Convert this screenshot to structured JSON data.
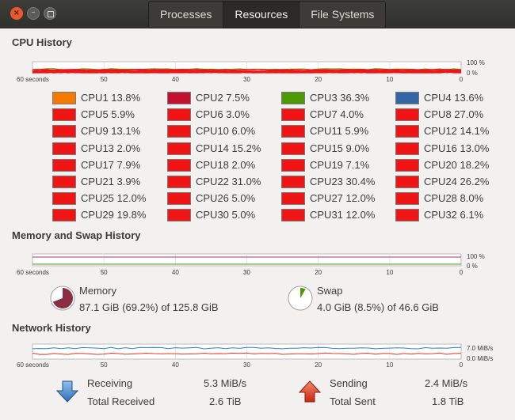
{
  "window": {
    "close_glyph": "×",
    "minimize_glyph": "–"
  },
  "tabs": [
    {
      "label": "Processes"
    },
    {
      "label": "Resources"
    },
    {
      "label": "File Systems"
    }
  ],
  "cpu_section": {
    "title": "CPU History",
    "axis_left": "60 seconds",
    "ticks": [
      "50",
      "40",
      "30",
      "20",
      "10",
      "0"
    ],
    "ymax": "100 %",
    "ymin": "0 %",
    "cpus": [
      {
        "label": "CPU1 13.8%",
        "color": "#f57900"
      },
      {
        "label": "CPU2 7.5%",
        "color": "#c4102f"
      },
      {
        "label": "CPU3 36.3%",
        "color": "#4e9a06"
      },
      {
        "label": "CPU4 13.6%",
        "color": "#3465a4"
      },
      {
        "label": "CPU5 5.9%",
        "color": "#ef1515"
      },
      {
        "label": "CPU6 3.0%",
        "color": "#ef1515"
      },
      {
        "label": "CPU7 4.0%",
        "color": "#ef1515"
      },
      {
        "label": "CPU8 27.0%",
        "color": "#ef1515"
      },
      {
        "label": "CPU9 13.1%",
        "color": "#ef1515"
      },
      {
        "label": "CPU10 6.0%",
        "color": "#ef1515"
      },
      {
        "label": "CPU11 5.9%",
        "color": "#ef1515"
      },
      {
        "label": "CPU12 14.1%",
        "color": "#ef1515"
      },
      {
        "label": "CPU13 2.0%",
        "color": "#ef1515"
      },
      {
        "label": "CPU14 15.2%",
        "color": "#ef1515"
      },
      {
        "label": "CPU15 9.0%",
        "color": "#ef1515"
      },
      {
        "label": "CPU16 13.0%",
        "color": "#ef1515"
      },
      {
        "label": "CPU17 7.9%",
        "color": "#ef1515"
      },
      {
        "label": "CPU18 2.0%",
        "color": "#ef1515"
      },
      {
        "label": "CPU19 7.1%",
        "color": "#ef1515"
      },
      {
        "label": "CPU20 18.2%",
        "color": "#ef1515"
      },
      {
        "label": "CPU21 3.9%",
        "color": "#ef1515"
      },
      {
        "label": "CPU22 31.0%",
        "color": "#ef1515"
      },
      {
        "label": "CPU23 30.4%",
        "color": "#ef1515"
      },
      {
        "label": "CPU24 26.2%",
        "color": "#ef1515"
      },
      {
        "label": "CPU25 12.0%",
        "color": "#ef1515"
      },
      {
        "label": "CPU26 5.0%",
        "color": "#ef1515"
      },
      {
        "label": "CPU27 12.0%",
        "color": "#ef1515"
      },
      {
        "label": "CPU28 8.0%",
        "color": "#ef1515"
      },
      {
        "label": "CPU29 19.8%",
        "color": "#ef1515"
      },
      {
        "label": "CPU30 5.0%",
        "color": "#ef1515"
      },
      {
        "label": "CPU31 12.0%",
        "color": "#ef1515"
      },
      {
        "label": "CPU32 6.1%",
        "color": "#ef1515"
      }
    ]
  },
  "memory_section": {
    "title": "Memory and Swap History",
    "axis_left": "60 seconds",
    "ticks": [
      "50",
      "40",
      "30",
      "20",
      "10",
      "0"
    ],
    "ymax": "100 %",
    "ymin": "0 %",
    "memory_label": "Memory",
    "memory_value": "87.1 GiB (69.2%) of 125.8 GiB",
    "memory_fraction": 0.692,
    "memory_color": "#8b2e44",
    "swap_label": "Swap",
    "swap_value": "4.0 GiB (8.5%) of 46.6 GiB",
    "swap_fraction": 0.085,
    "swap_color": "#4e9a06"
  },
  "network_section": {
    "title": "Network History",
    "axis_left": "60 seconds",
    "ticks": [
      "50",
      "40",
      "30",
      "20",
      "10",
      "0"
    ],
    "ymax": "7.0 MiB/s",
    "ymin": "0.0 MiB/s",
    "receiving_label": "Receiving",
    "receiving_value": "5.3 MiB/s",
    "total_received_label": "Total Received",
    "total_received_value": "2.6 TiB",
    "sending_label": "Sending",
    "sending_value": "2.4 MiB/s",
    "total_sent_label": "Total Sent",
    "total_sent_value": "1.8 TiB",
    "receive_color": "#2f7dd1",
    "send_color": "#e8361e"
  }
}
